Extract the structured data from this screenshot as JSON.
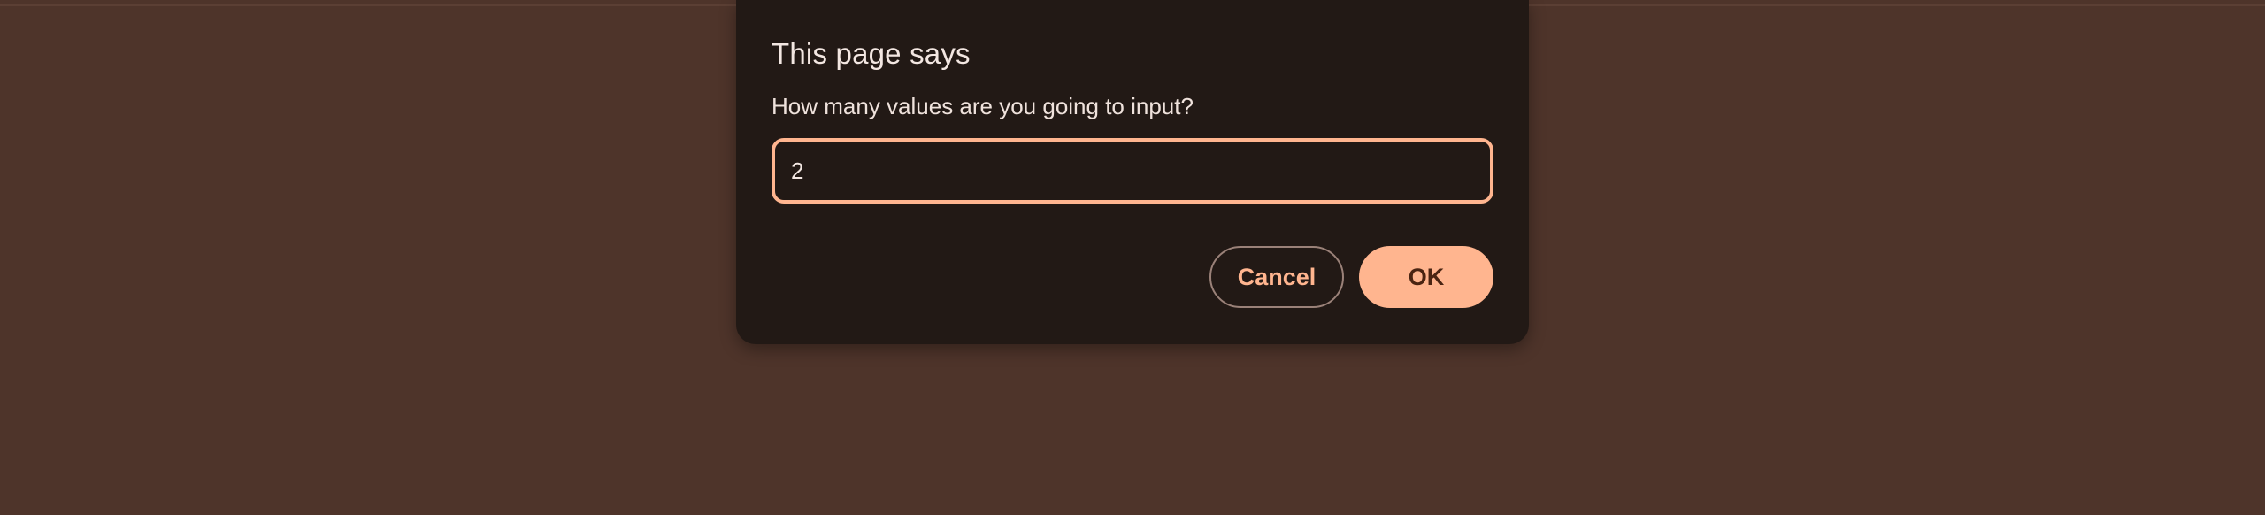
{
  "dialog": {
    "title": "This page says",
    "message": "How many values are you going to input?",
    "input_value": "2",
    "cancel_label": "Cancel",
    "ok_label": "OK"
  },
  "colors": {
    "page_background": "#4e342a",
    "dialog_background": "#221915",
    "accent": "#ffb58f",
    "text": "#f3e7e2"
  }
}
